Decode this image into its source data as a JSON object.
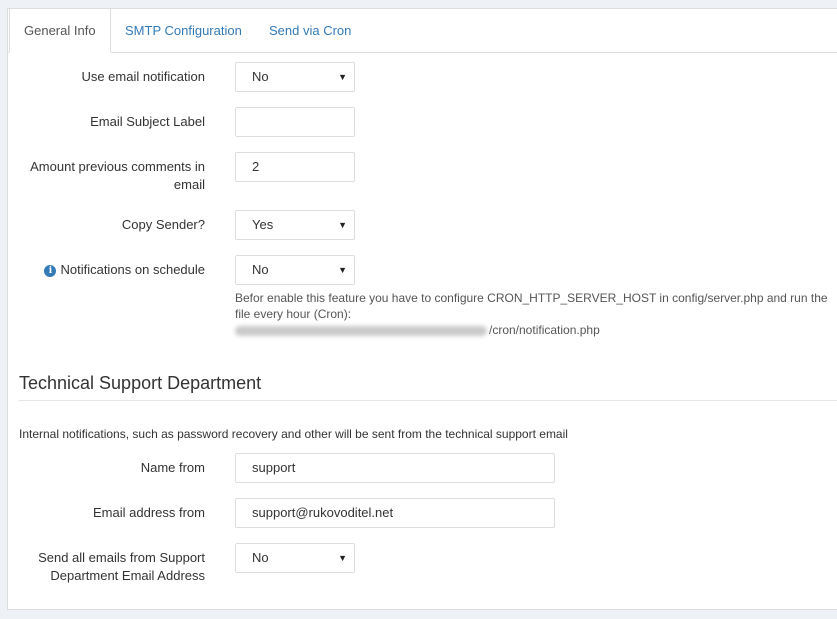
{
  "tabs": [
    {
      "label": "General Info"
    },
    {
      "label": "SMTP Configuration"
    },
    {
      "label": "Send via Cron"
    }
  ],
  "general": {
    "use_email_notification": {
      "label": "Use email notification",
      "value": "No"
    },
    "email_subject_label": {
      "label": "Email Subject Label",
      "value": ""
    },
    "amount_previous_comments": {
      "label_line1": "Amount previous comments in",
      "label_line2": "email",
      "value": "2"
    },
    "copy_sender": {
      "label": "Copy Sender?",
      "value": "Yes"
    },
    "notifications_on_schedule": {
      "label": "Notifications on schedule",
      "value": "No",
      "hint_line1": "Befor enable this feature you have to configure CRON_HTTP_SERVER_HOST in config/server.php and run the",
      "hint_line2": "file every hour (Cron):",
      "hint_path_suffix": "/cron/notification.php"
    }
  },
  "support": {
    "title": "Technical Support Department",
    "note": "Internal notifications, such as password recovery and other will be sent from the technical support email",
    "name_from": {
      "label": "Name from",
      "value": "support"
    },
    "email_from": {
      "label": "Email address from",
      "value": "support@rukovoditel.net"
    },
    "send_all_from_support": {
      "label_line1": "Send all emails from Support",
      "label_line2": "Department Email Address",
      "value": "No"
    }
  },
  "colors": {
    "link": "#337ab7",
    "border": "#dddddd",
    "background": "#eef1f5"
  },
  "icons": {
    "select_arrow": "▼",
    "info": "i"
  }
}
